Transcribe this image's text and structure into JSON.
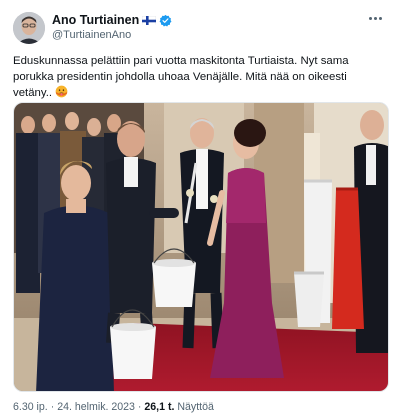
{
  "author": {
    "name": "Ano Turtiainen",
    "handle": "@TurtiainenAno",
    "flag_icon": "finland-flag-icon",
    "verified_icon": "verified-badge-icon",
    "verified_color": "#1d9bf0"
  },
  "tweet": {
    "text": "Eduskunnassa pelättiin pari vuotta maskitonta Turtiaista. Nyt sama porukka presidentin johdolla uhoaa Venäjälle. Mitä nää on oikeesti vetäny..",
    "emoji_icon": "hot-face-emoji-icon"
  },
  "meta": {
    "time": "6.30 ip.",
    "separator": "·",
    "date": "24. helmik. 2023",
    "views_count": "26,1 t.",
    "views_label": "Näyttöä"
  },
  "colors": {
    "text_primary": "#0f1419",
    "text_secondary": "#536471",
    "carpet": "#a8182c",
    "bucket_red": "#d42a1e"
  }
}
